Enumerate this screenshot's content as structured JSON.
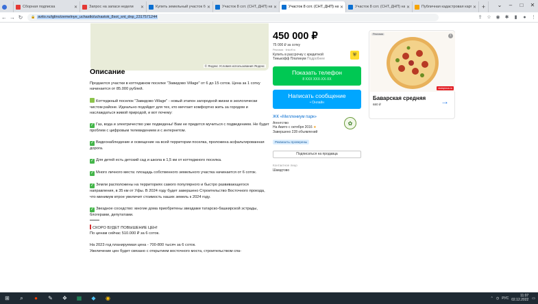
{
  "tabs": [
    {
      "title": "Сборная подписка",
      "color": "#e53935"
    },
    {
      "title": "Запрос на запаси недели",
      "color": "#e53935"
    },
    {
      "title": "Купить земельный участок б",
      "color": "#0a6fd1"
    },
    {
      "title": "Участок 8 сот. (СНТ, ДНП) на",
      "color": "#0a6fd1"
    },
    {
      "title": "Участок 8 сот. (СНТ, ДНП) на",
      "color": "#0a6fd1",
      "active": true
    },
    {
      "title": "Участок 8 сот. (СНТ, ДНП) на",
      "color": "#0a6fd1"
    },
    {
      "title": "Публичная кадастровая карт",
      "color": "#f6a400"
    }
  ],
  "browser": {
    "url": "avito.ru/iglino/zemelnye_uchastki/uchastok_8sot_snt_dnp_2317571244",
    "new_tab": "+"
  },
  "map": {
    "caption": "© Яндекс Условия использования  Яндекс"
  },
  "description": {
    "title": "Описание",
    "paragraphs": [
      {
        "icon": "",
        "text": "Продаются участки в коттеджном поселке \"Завидово Village\" от 6 до 15 соток. Цена за 1 сотку начинается от 85.000 рублей."
      },
      {
        "icon": "house",
        "text": "Коттеджный поселок \"Завидово Village\" - новый этапон загородной жизни в экологически чистом районе. Идеально подойдет для тех, кто мечтает комфортно жить за городом и наслаждаться живой природой, и вот почему:"
      },
      {
        "icon": "check",
        "text": "Газ, вода и электричество уже подведены! Вам не придется мучиться с подведением. Не будет проблем с цифровым телевидением и с интернетом."
      },
      {
        "icon": "check",
        "text": "Видеонаблюдение и освещение на всей территории поселка, проложена асфальтированная дорога."
      },
      {
        "icon": "check",
        "text": "Для детей есть детский сад и школа в 1,5 км от коттеджного поселка."
      },
      {
        "icon": "check",
        "text": "Много личного места: площадь собственного земельного участка начинается от 6 соток."
      },
      {
        "icon": "check",
        "text": "Земли расположены на территориях самого популярного и быстро развивающегося направления, в 35 км от Уфы. В 2024 году будет завершено Строительство Восточного проезда, что минимум втрое увеличит стоимость наших земель к 2024 году."
      },
      {
        "icon": "check",
        "text": "Звездное соседство: многие дома приобретены звездами татарско-башкирской эстрады, блогерами, депутатами."
      }
    ],
    "alert_title": "СКОРО БУДЕТ ПОВЫШЕНИЕ ЦЕН!",
    "alert_line": "По ценам сейчас 510.000 ₽ за 6 соток.",
    "plan_line1": "На 2023 год планируемая цена - 700-800 тысяч за 6 соток.",
    "plan_line2": "Увеличение цен будет связано с открытием восточного моста, строительством спа-"
  },
  "listing": {
    "price": "450 000 ₽",
    "per_unit": "75 000 ₽ за сотку",
    "ad_label": "Реклама · tinkoff.ru",
    "credit_line1": "Купить в рассрочку с кредитной",
    "credit_line2": "Тинькофф Платинум",
    "credit_more": "Подробнее",
    "phone_button": "Показать телефон",
    "phone_masked": "8 XXX XXX-XX-XX",
    "message_button": "Написать сообщение",
    "message_status": "• Онлайн",
    "seller_name": "ЖК «Миллениум парк»",
    "seller_type": "Агентство",
    "seller_since": "На Авито с октября 2016",
    "seller_count": "Завершено 228 объявлений",
    "requisites_badge": "Реквизиты проверены",
    "subscribe_button": "Подписаться на продавца",
    "contact_label": "Контактное лицо",
    "contact_name": "Шамдтово"
  },
  "side_ad": {
    "tag": "Реклама",
    "info": "i",
    "brand": "dodopizza.ru",
    "title": "Баварская средняя",
    "price": "680 ₽",
    "arrow": "→"
  },
  "taskbar": {
    "lang": "РУС",
    "time": "11:07",
    "date": "02.12.2022"
  }
}
